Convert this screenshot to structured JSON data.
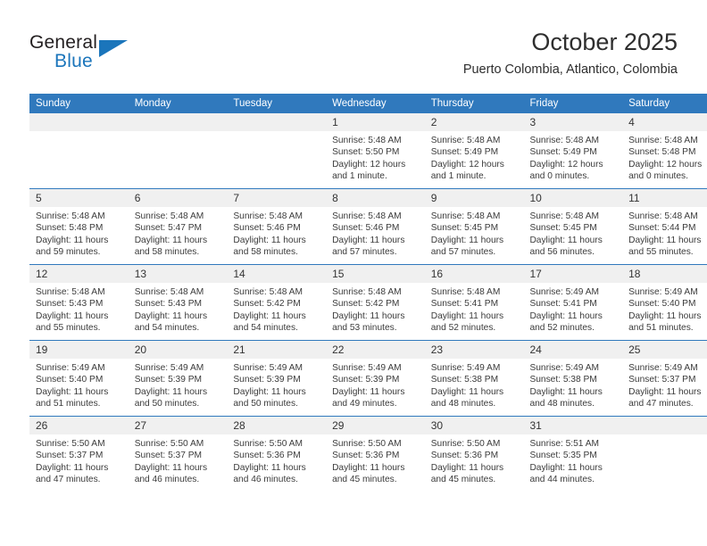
{
  "logo": {
    "word_one": "General",
    "word_two": "Blue",
    "accent_color": "#1b75bb",
    "text_color": "#231f20",
    "triangle_icon": "triangle-icon"
  },
  "header": {
    "title": "October 2025",
    "subtitle": "Puerto Colombia, Atlantico, Colombia"
  },
  "calendar": {
    "header_bg": "#3079bd",
    "daynum_bg": "#f0f0f0",
    "weekday_headers": [
      "Sunday",
      "Monday",
      "Tuesday",
      "Wednesday",
      "Thursday",
      "Friday",
      "Saturday"
    ],
    "weeks": [
      [
        {
          "day": "",
          "sunrise": "",
          "sunset": "",
          "daylight_line1": "",
          "daylight_line2": "",
          "empty": true
        },
        {
          "day": "",
          "sunrise": "",
          "sunset": "",
          "daylight_line1": "",
          "daylight_line2": "",
          "empty": true
        },
        {
          "day": "",
          "sunrise": "",
          "sunset": "",
          "daylight_line1": "",
          "daylight_line2": "",
          "empty": true
        },
        {
          "day": "1",
          "sunrise": "Sunrise: 5:48 AM",
          "sunset": "Sunset: 5:50 PM",
          "daylight_line1": "Daylight: 12 hours",
          "daylight_line2": "and 1 minute.",
          "empty": false
        },
        {
          "day": "2",
          "sunrise": "Sunrise: 5:48 AM",
          "sunset": "Sunset: 5:49 PM",
          "daylight_line1": "Daylight: 12 hours",
          "daylight_line2": "and 1 minute.",
          "empty": false
        },
        {
          "day": "3",
          "sunrise": "Sunrise: 5:48 AM",
          "sunset": "Sunset: 5:49 PM",
          "daylight_line1": "Daylight: 12 hours",
          "daylight_line2": "and 0 minutes.",
          "empty": false
        },
        {
          "day": "4",
          "sunrise": "Sunrise: 5:48 AM",
          "sunset": "Sunset: 5:48 PM",
          "daylight_line1": "Daylight: 12 hours",
          "daylight_line2": "and 0 minutes.",
          "empty": false
        }
      ],
      [
        {
          "day": "5",
          "sunrise": "Sunrise: 5:48 AM",
          "sunset": "Sunset: 5:48 PM",
          "daylight_line1": "Daylight: 11 hours",
          "daylight_line2": "and 59 minutes.",
          "empty": false
        },
        {
          "day": "6",
          "sunrise": "Sunrise: 5:48 AM",
          "sunset": "Sunset: 5:47 PM",
          "daylight_line1": "Daylight: 11 hours",
          "daylight_line2": "and 58 minutes.",
          "empty": false
        },
        {
          "day": "7",
          "sunrise": "Sunrise: 5:48 AM",
          "sunset": "Sunset: 5:46 PM",
          "daylight_line1": "Daylight: 11 hours",
          "daylight_line2": "and 58 minutes.",
          "empty": false
        },
        {
          "day": "8",
          "sunrise": "Sunrise: 5:48 AM",
          "sunset": "Sunset: 5:46 PM",
          "daylight_line1": "Daylight: 11 hours",
          "daylight_line2": "and 57 minutes.",
          "empty": false
        },
        {
          "day": "9",
          "sunrise": "Sunrise: 5:48 AM",
          "sunset": "Sunset: 5:45 PM",
          "daylight_line1": "Daylight: 11 hours",
          "daylight_line2": "and 57 minutes.",
          "empty": false
        },
        {
          "day": "10",
          "sunrise": "Sunrise: 5:48 AM",
          "sunset": "Sunset: 5:45 PM",
          "daylight_line1": "Daylight: 11 hours",
          "daylight_line2": "and 56 minutes.",
          "empty": false
        },
        {
          "day": "11",
          "sunrise": "Sunrise: 5:48 AM",
          "sunset": "Sunset: 5:44 PM",
          "daylight_line1": "Daylight: 11 hours",
          "daylight_line2": "and 55 minutes.",
          "empty": false
        }
      ],
      [
        {
          "day": "12",
          "sunrise": "Sunrise: 5:48 AM",
          "sunset": "Sunset: 5:43 PM",
          "daylight_line1": "Daylight: 11 hours",
          "daylight_line2": "and 55 minutes.",
          "empty": false
        },
        {
          "day": "13",
          "sunrise": "Sunrise: 5:48 AM",
          "sunset": "Sunset: 5:43 PM",
          "daylight_line1": "Daylight: 11 hours",
          "daylight_line2": "and 54 minutes.",
          "empty": false
        },
        {
          "day": "14",
          "sunrise": "Sunrise: 5:48 AM",
          "sunset": "Sunset: 5:42 PM",
          "daylight_line1": "Daylight: 11 hours",
          "daylight_line2": "and 54 minutes.",
          "empty": false
        },
        {
          "day": "15",
          "sunrise": "Sunrise: 5:48 AM",
          "sunset": "Sunset: 5:42 PM",
          "daylight_line1": "Daylight: 11 hours",
          "daylight_line2": "and 53 minutes.",
          "empty": false
        },
        {
          "day": "16",
          "sunrise": "Sunrise: 5:48 AM",
          "sunset": "Sunset: 5:41 PM",
          "daylight_line1": "Daylight: 11 hours",
          "daylight_line2": "and 52 minutes.",
          "empty": false
        },
        {
          "day": "17",
          "sunrise": "Sunrise: 5:49 AM",
          "sunset": "Sunset: 5:41 PM",
          "daylight_line1": "Daylight: 11 hours",
          "daylight_line2": "and 52 minutes.",
          "empty": false
        },
        {
          "day": "18",
          "sunrise": "Sunrise: 5:49 AM",
          "sunset": "Sunset: 5:40 PM",
          "daylight_line1": "Daylight: 11 hours",
          "daylight_line2": "and 51 minutes.",
          "empty": false
        }
      ],
      [
        {
          "day": "19",
          "sunrise": "Sunrise: 5:49 AM",
          "sunset": "Sunset: 5:40 PM",
          "daylight_line1": "Daylight: 11 hours",
          "daylight_line2": "and 51 minutes.",
          "empty": false
        },
        {
          "day": "20",
          "sunrise": "Sunrise: 5:49 AM",
          "sunset": "Sunset: 5:39 PM",
          "daylight_line1": "Daylight: 11 hours",
          "daylight_line2": "and 50 minutes.",
          "empty": false
        },
        {
          "day": "21",
          "sunrise": "Sunrise: 5:49 AM",
          "sunset": "Sunset: 5:39 PM",
          "daylight_line1": "Daylight: 11 hours",
          "daylight_line2": "and 50 minutes.",
          "empty": false
        },
        {
          "day": "22",
          "sunrise": "Sunrise: 5:49 AM",
          "sunset": "Sunset: 5:39 PM",
          "daylight_line1": "Daylight: 11 hours",
          "daylight_line2": "and 49 minutes.",
          "empty": false
        },
        {
          "day": "23",
          "sunrise": "Sunrise: 5:49 AM",
          "sunset": "Sunset: 5:38 PM",
          "daylight_line1": "Daylight: 11 hours",
          "daylight_line2": "and 48 minutes.",
          "empty": false
        },
        {
          "day": "24",
          "sunrise": "Sunrise: 5:49 AM",
          "sunset": "Sunset: 5:38 PM",
          "daylight_line1": "Daylight: 11 hours",
          "daylight_line2": "and 48 minutes.",
          "empty": false
        },
        {
          "day": "25",
          "sunrise": "Sunrise: 5:49 AM",
          "sunset": "Sunset: 5:37 PM",
          "daylight_line1": "Daylight: 11 hours",
          "daylight_line2": "and 47 minutes.",
          "empty": false
        }
      ],
      [
        {
          "day": "26",
          "sunrise": "Sunrise: 5:50 AM",
          "sunset": "Sunset: 5:37 PM",
          "daylight_line1": "Daylight: 11 hours",
          "daylight_line2": "and 47 minutes.",
          "empty": false
        },
        {
          "day": "27",
          "sunrise": "Sunrise: 5:50 AM",
          "sunset": "Sunset: 5:37 PM",
          "daylight_line1": "Daylight: 11 hours",
          "daylight_line2": "and 46 minutes.",
          "empty": false
        },
        {
          "day": "28",
          "sunrise": "Sunrise: 5:50 AM",
          "sunset": "Sunset: 5:36 PM",
          "daylight_line1": "Daylight: 11 hours",
          "daylight_line2": "and 46 minutes.",
          "empty": false
        },
        {
          "day": "29",
          "sunrise": "Sunrise: 5:50 AM",
          "sunset": "Sunset: 5:36 PM",
          "daylight_line1": "Daylight: 11 hours",
          "daylight_line2": "and 45 minutes.",
          "empty": false
        },
        {
          "day": "30",
          "sunrise": "Sunrise: 5:50 AM",
          "sunset": "Sunset: 5:36 PM",
          "daylight_line1": "Daylight: 11 hours",
          "daylight_line2": "and 45 minutes.",
          "empty": false
        },
        {
          "day": "31",
          "sunrise": "Sunrise: 5:51 AM",
          "sunset": "Sunset: 5:35 PM",
          "daylight_line1": "Daylight: 11 hours",
          "daylight_line2": "and 44 minutes.",
          "empty": false
        },
        {
          "day": "",
          "sunrise": "",
          "sunset": "",
          "daylight_line1": "",
          "daylight_line2": "",
          "empty": true
        }
      ]
    ]
  }
}
